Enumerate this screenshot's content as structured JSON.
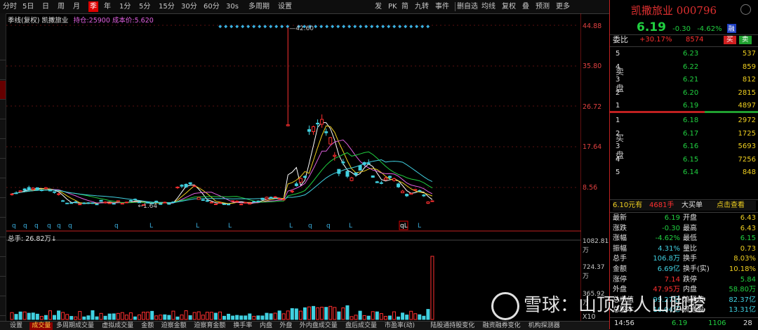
{
  "toolbar": {
    "items": [
      "分时",
      "5日",
      "日",
      "周",
      "月",
      "季",
      "年",
      "1分",
      "5分",
      "15分",
      "30分",
      "60分",
      "30s",
      "多周期",
      "设置"
    ],
    "active": "季",
    "right_items": [
      "发",
      "PK",
      "简",
      "九转",
      "事件",
      "删自选",
      "均线",
      "复权",
      "叠",
      "预测",
      "更多"
    ]
  },
  "chart": {
    "title": "季线(复权) 凯撒旅业",
    "hold_text": "持仓:25900 成本价:5.620",
    "max_label": "42.60",
    "min_label": "1.64",
    "axis_labels": [
      "44.88",
      "35.80",
      "26.72",
      "17.64",
      "8.56"
    ],
    "volume_title": "总手: 26.82万↓",
    "volume_axis": [
      "1082.81万",
      "724.37万",
      "365.92万"
    ],
    "scale_label": "X10",
    "q_marks": [
      "q",
      "q",
      "q",
      "q",
      "q",
      "q",
      "q",
      "L",
      "L",
      "L",
      "L",
      "q",
      "q",
      "L",
      "qL",
      "L"
    ]
  },
  "bottom_tabs": {
    "items": [
      "设置",
      "成交量",
      "多周期成交量",
      "虚拟成交量",
      "金额",
      "迫察金额",
      "迫察育金额",
      "换手率",
      "内盘",
      "外盘",
      "外内盘成交量",
      "盘后成交量",
      "市盈率(动)",
      "陆股通持股变化",
      "融资融券变化",
      "机构探测器"
    ],
    "active": "成交量"
  },
  "quote": {
    "name": "凯撒旅业",
    "code": "000796",
    "price": "6.19",
    "change": "-0.30",
    "pct": "-4.62%",
    "badge": "融",
    "weibi_label": "委比",
    "weibi_val": "+30.17%",
    "weibi_num": "8574",
    "buy_btn": "买",
    "sell_btn": "卖",
    "sell_label": "卖盘",
    "buy_label": "买盘",
    "asks": [
      {
        "lvl": "5",
        "price": "6.23",
        "vol": "537"
      },
      {
        "lvl": "4",
        "price": "6.22",
        "vol": "859"
      },
      {
        "lvl": "3",
        "price": "6.21",
        "vol": "812"
      },
      {
        "lvl": "2",
        "price": "6.20",
        "vol": "2815"
      },
      {
        "lvl": "1",
        "price": "6.19",
        "vol": "4897"
      }
    ],
    "bids": [
      {
        "lvl": "1",
        "price": "6.18",
        "vol": "2972"
      },
      {
        "lvl": "2",
        "price": "6.17",
        "vol": "1725"
      },
      {
        "lvl": "3",
        "price": "6.16",
        "vol": "5693"
      },
      {
        "lvl": "4",
        "price": "6.15",
        "vol": "7256"
      },
      {
        "lvl": "5",
        "price": "6.14",
        "vol": "848"
      }
    ],
    "bigorder": {
      "price": "6.10元有",
      "hands": "4681手",
      "label": "大买单",
      "link": "点击查看"
    },
    "stats": [
      {
        "l1": "最新",
        "v1": "6.19",
        "c1": "green",
        "l2": "开盘",
        "v2": "6.43",
        "c2": "yellow"
      },
      {
        "l1": "涨跌",
        "v1": "-0.30",
        "c1": "green",
        "l2": "最高",
        "v2": "6.43",
        "c2": "yellow"
      },
      {
        "l1": "涨幅",
        "v1": "-4.62%",
        "c1": "green",
        "l2": "最低",
        "v2": "6.15",
        "c2": "green"
      },
      {
        "l1": "振幅",
        "v1": "4.31%",
        "c1": "cyan",
        "l2": "量比",
        "v2": "0.73",
        "c2": "yellow"
      },
      {
        "l1": "总手",
        "v1": "106.8万",
        "c1": "cyan",
        "l2": "换手",
        "v2": "8.03%",
        "c2": "yellow"
      },
      {
        "l1": "金额",
        "v1": "6.69亿",
        "c1": "cyan",
        "l2": "换手(实)",
        "v2": "10.18%",
        "c2": "yellow"
      },
      {
        "l1": "涨停",
        "v1": "7.14",
        "c1": "red",
        "l2": "跌停",
        "v2": "5.84",
        "c2": "green"
      },
      {
        "l1": "外盘",
        "v1": "47.95万",
        "c1": "red",
        "l2": "内盘",
        "v2": "58.80万",
        "c2": "green"
      },
      {
        "l1": "总市值",
        "v1": "99.27亿",
        "c1": "cyan",
        "l2": "流通值",
        "v2": "82.37亿",
        "c2": "cyan"
      },
      {
        "l1": "总股本",
        "v1": "16.04亿",
        "c1": "cyan",
        "l2": "流通股",
        "v2": "13.31亿",
        "c2": "cyan"
      }
    ],
    "tick": {
      "time": "14:56",
      "price": "6.19",
      "vol": "1106",
      "num": "28"
    }
  },
  "watermark": "雪球：山顶冻人山脚挖",
  "colors": {
    "up": "#ff3030",
    "down": "#20d040",
    "bg": "#000000",
    "accent": "#d00000"
  }
}
